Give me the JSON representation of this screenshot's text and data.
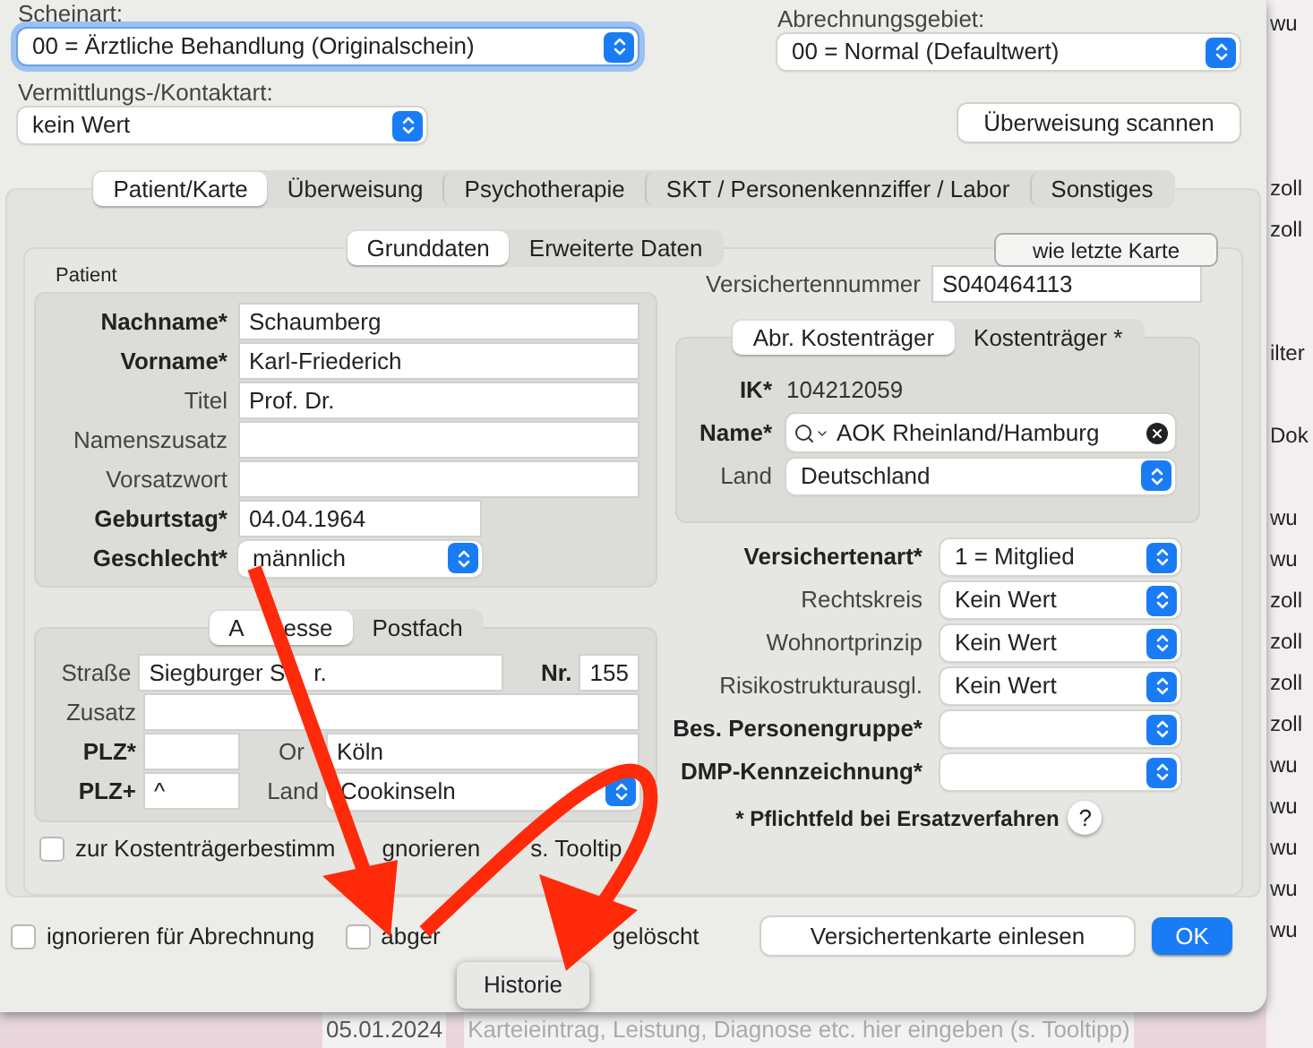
{
  "header_selects": [
    {
      "label": "Scheinart:",
      "value": "00 = Ärztliche Behandlung (Originalschein)",
      "focused": true
    },
    {
      "label": "Abrechnungsgebiet:",
      "value": "00 = Normal (Defaultwert)",
      "focused": false
    },
    {
      "label": "Vermittlungs-/Kontaktart:",
      "value": "kein Wert",
      "focused": false
    }
  ],
  "scan_button": "Überweisung scannen",
  "tabs": [
    {
      "label": "Patient/Karte",
      "selected": true
    },
    {
      "label": "Überweisung",
      "selected": false
    },
    {
      "label": "Psychotherapie",
      "selected": false
    },
    {
      "label": "SKT / Personenkennziffer / Labor",
      "selected": false
    },
    {
      "label": "Sonstiges",
      "selected": false
    }
  ],
  "subtabs": [
    {
      "label": "Grunddaten",
      "selected": true
    },
    {
      "label": "Erweiterte Daten",
      "selected": false
    }
  ],
  "copy_button": "wie letzte Karte",
  "patient": {
    "title": "Patient",
    "fields": [
      {
        "kind": "text",
        "label": "Nachname*",
        "value": "Schaumberg",
        "required": true
      },
      {
        "kind": "text",
        "label": "Vorname*",
        "value": "Karl-Friederich",
        "required": true
      },
      {
        "kind": "text",
        "label": "Titel",
        "value": "Prof. Dr.",
        "required": false
      },
      {
        "kind": "text",
        "label": "Namenszusatz",
        "required": false
      },
      {
        "kind": "text",
        "label": "Vorsatzwort",
        "required": false
      },
      {
        "kind": "date",
        "label": "Geburtstag*",
        "value": "04.04.1964",
        "required": true
      },
      {
        "kind": "select",
        "label": "Geschlecht*",
        "value": "männlich",
        "required": true
      }
    ]
  },
  "insurance_number": {
    "label": "Versichertennummer",
    "value": "S040464113"
  },
  "payer": {
    "tabs": [
      {
        "label": "Abr. Kostenträger",
        "selected": true
      },
      {
        "label": "Kostenträger *",
        "selected": false
      }
    ],
    "ik": {
      "label": "IK*",
      "value": "104212059"
    },
    "name": {
      "label": "Name*",
      "value": "AOK Rheinland/Hamburg"
    },
    "country": {
      "label": "Land",
      "value": "Deutschland"
    }
  },
  "insurance_fields": [
    {
      "label": "Versichertenart*",
      "value": "1 = Mitglied",
      "required": true
    },
    {
      "label": "Rechtskreis",
      "value": "Kein Wert",
      "required": false
    },
    {
      "label": "Wohnortprinzip",
      "value": "Kein Wert",
      "required": false
    },
    {
      "label": "Risikostrukturausgl.",
      "value": "Kein Wert",
      "required": false
    },
    {
      "label": "Bes. Personengruppe*",
      "required": true
    },
    {
      "label": "DMP-Kennzeichnung*",
      "required": true
    }
  ],
  "footnote": {
    "text": "* Pflichtfeld bei Ersatzverfahren",
    "help": "?"
  },
  "address": {
    "tabs": [
      {
        "label_parts": [
          "A",
          "esse"
        ],
        "selected": true
      },
      {
        "label": "Postfach",
        "selected": false
      }
    ],
    "street": {
      "label": "Straße",
      "value_parts": [
        "Siegburger S",
        "r."
      ]
    },
    "number": {
      "label": "Nr.",
      "value": "155"
    },
    "addition": {
      "label": "Zusatz"
    },
    "zip": {
      "label": "PLZ*"
    },
    "city": {
      "label": "Or",
      "value": "Köln"
    },
    "zip_plus": {
      "label": "PLZ+",
      "value": "^"
    },
    "country": {
      "label": "Land",
      "value": "Cookinseln"
    }
  },
  "ignore_checkbox": {
    "label_parts": [
      "zur Kostenträgerbestimm",
      "gnorieren",
      "s. Tooltip"
    ],
    "checked": false
  },
  "bottom_checkboxes": [
    {
      "label": "ignorieren für Abrechnung",
      "checked": false
    },
    {
      "label": "abger",
      "checked": false
    }
  ],
  "deleted_label": "gelöscht",
  "read_card_button": "Versichertenkarte einlesen",
  "ok_button": "OK",
  "tooltip": "Historie",
  "background": {
    "rows": [
      {
        "kind": "row",
        "text": "wu"
      },
      {
        "kind": "gap"
      },
      {
        "kind": "gap"
      },
      {
        "kind": "gap"
      },
      {
        "kind": "row",
        "text": "zoll"
      },
      {
        "kind": "row",
        "text": "zoll"
      },
      {
        "kind": "gap"
      },
      {
        "kind": "gap"
      },
      {
        "kind": "row",
        "text": "ilter"
      },
      {
        "kind": "gap"
      },
      {
        "kind": "row",
        "text": "Dok"
      },
      {
        "kind": "gap"
      },
      {
        "kind": "row",
        "text": "wu"
      },
      {
        "kind": "row",
        "text": "wu"
      },
      {
        "kind": "row",
        "text": "zoll"
      },
      {
        "kind": "row",
        "text": "zoll"
      },
      {
        "kind": "row",
        "text": "zoll"
      },
      {
        "kind": "row",
        "text": "zoll"
      },
      {
        "kind": "row",
        "text": "wu"
      },
      {
        "kind": "row",
        "text": "wu"
      },
      {
        "kind": "row",
        "text": "wu"
      },
      {
        "kind": "row",
        "text": "wu"
      },
      {
        "kind": "row",
        "text": "wu"
      }
    ],
    "date": "05.01.2024",
    "entry_placeholder": "Karteieintrag, Leistung, Diagnose etc. hier eingeben (s. Tooltipp)"
  }
}
